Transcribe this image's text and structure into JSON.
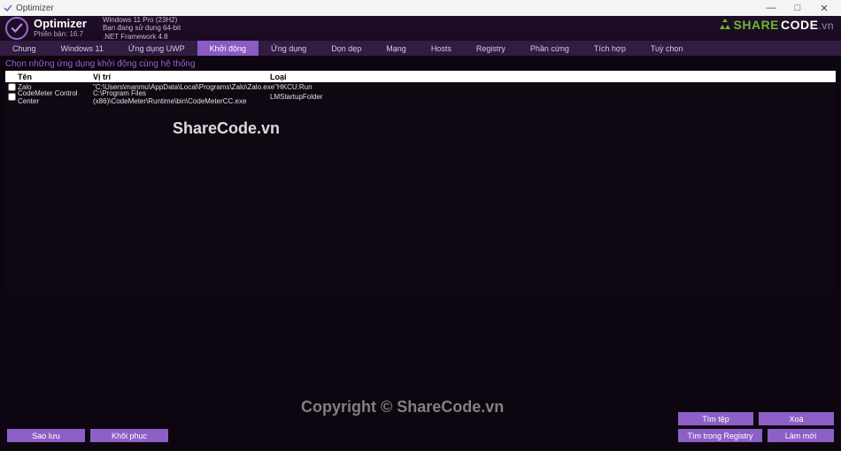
{
  "window": {
    "title": "Optimizer",
    "minimize": "—",
    "maximize": "□",
    "close": "✕"
  },
  "header": {
    "app_name": "Optimizer",
    "version_label": "Phiên bản: 16.7",
    "sys_line1": "Windows 11 Pro (23H2)",
    "sys_line2": "Bạn đang sử dụng 64-bit",
    "sys_line3": ".NET Framework 4.8",
    "brand_share": "SHARE",
    "brand_code": "CODE",
    "brand_vn": ".vn"
  },
  "tabs": [
    {
      "label": "Chung",
      "active": false
    },
    {
      "label": "Windows 11",
      "active": false
    },
    {
      "label": "Ứng dụng UWP",
      "active": false
    },
    {
      "label": "Khởi động",
      "active": true
    },
    {
      "label": "Ứng dụng",
      "active": false
    },
    {
      "label": "Dọn dẹp",
      "active": false
    },
    {
      "label": "Mạng",
      "active": false
    },
    {
      "label": "Hosts",
      "active": false
    },
    {
      "label": "Registry",
      "active": false
    },
    {
      "label": "Phần cứng",
      "active": false
    },
    {
      "label": "Tích hợp",
      "active": false
    },
    {
      "label": "Tuỳ chọn",
      "active": false
    }
  ],
  "subtitle": "Chọn những ứng dụng khởi động cùng hệ thống",
  "grid": {
    "columns": {
      "name": "Tên",
      "path": "Vị trí",
      "type": "Loại"
    },
    "rows": [
      {
        "name": "Zalo",
        "path": "\"C:\\Users\\manmu\\AppData\\Local\\Programs\\Zalo\\Zalo.exe\"",
        "type": "HKCU:Run"
      },
      {
        "name": "CodeMeter Control Center",
        "path": "C:\\Program Files (x86)\\CodeMeter\\Runtime\\bin\\CodeMeterCC.exe",
        "type": "LMStartupFolder"
      }
    ]
  },
  "buttons": {
    "backup": "Sao lưu",
    "restore": "Khôi phục",
    "find_file": "Tìm tệp",
    "delete": "Xoá",
    "find_registry": "Tìm trong Registry",
    "refresh": "Làm mới"
  },
  "watermark1": "ShareCode.vn",
  "watermark2": "Copyright © ShareCode.vn"
}
